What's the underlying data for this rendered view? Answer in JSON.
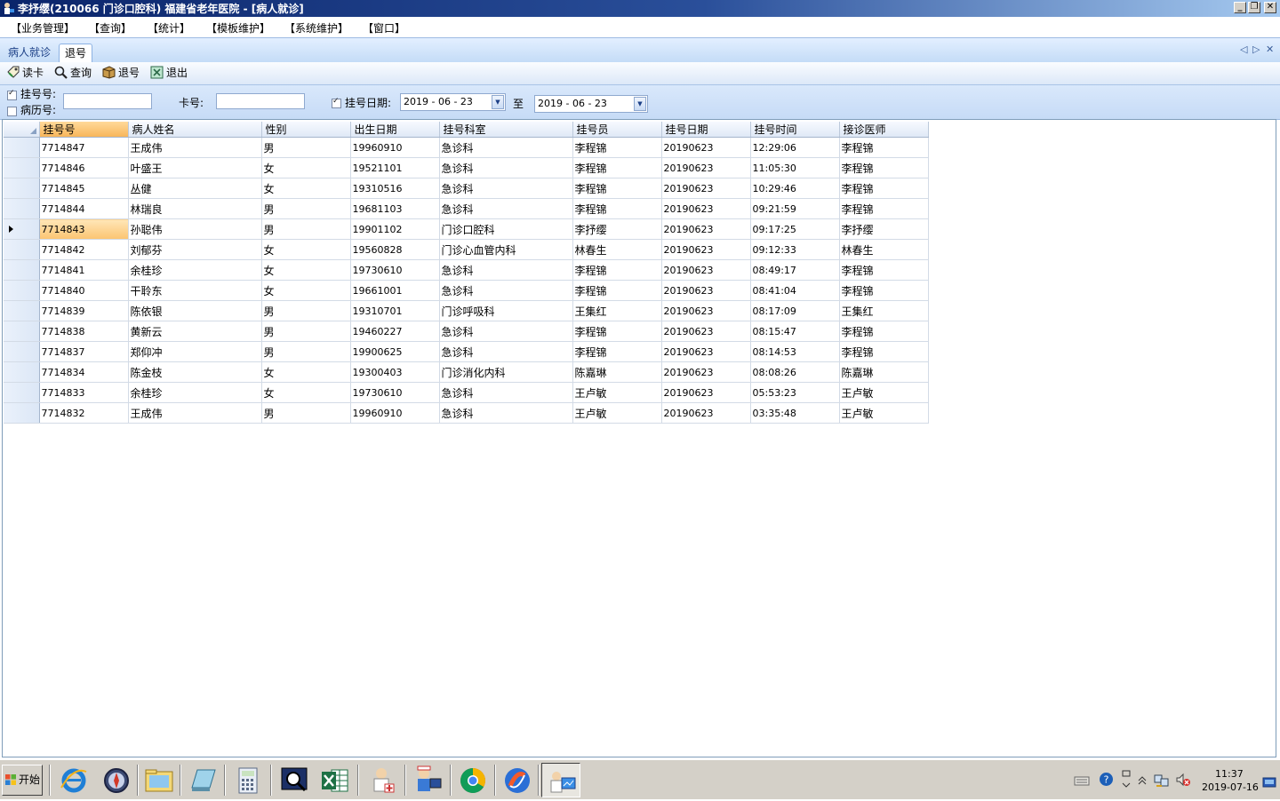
{
  "window": {
    "title": "李抒缨(210066 门诊口腔科) 福建省老年医院 - [病人就诊]",
    "controls": [
      "_",
      "❐",
      "✕"
    ]
  },
  "menu": [
    "【业务管理】",
    "【查询】",
    "【统计】",
    "【模板维护】",
    "【系统维护】",
    "【窗口】"
  ],
  "tabs": [
    {
      "label": "病人就诊",
      "active": false
    },
    {
      "label": "退号",
      "active": true
    }
  ],
  "tab_nav": {
    "prev": "◁",
    "next": "▷",
    "close": "✕"
  },
  "toolbar": {
    "read_card": "读卡",
    "query": "查询",
    "cancel_reg": "退号",
    "exit": "退出"
  },
  "filter": {
    "reg_no_label": "挂号号:",
    "reg_no_checked": true,
    "record_no_label": "病历号:",
    "record_no_checked": false,
    "reg_no_value": "",
    "card_label": "卡号:",
    "card_value": "",
    "date_label": "挂号日期:",
    "date_checked": true,
    "date_from": "2019 - 06 - 23",
    "to_label": "至",
    "date_to": "2019 - 06 - 23"
  },
  "grid": {
    "columns": [
      "挂号号",
      "病人姓名",
      "性别",
      "出生日期",
      "挂号科室",
      "挂号员",
      "挂号日期",
      "挂号时间",
      "接诊医师"
    ],
    "sorted_column": 0,
    "current_row": 4,
    "rows": [
      [
        "7714847",
        "王成伟",
        "男",
        "19960910",
        "急诊科",
        "李程锦",
        "20190623",
        "12:29:06",
        "李程锦"
      ],
      [
        "7714846",
        "叶盛王",
        "女",
        "19521101",
        "急诊科",
        "李程锦",
        "20190623",
        "11:05:30",
        "李程锦"
      ],
      [
        "7714845",
        "丛健",
        "女",
        "19310516",
        "急诊科",
        "李程锦",
        "20190623",
        "10:29:46",
        "李程锦"
      ],
      [
        "7714844",
        "林瑞良",
        "男",
        "19681103",
        "急诊科",
        "李程锦",
        "20190623",
        "09:21:59",
        "李程锦"
      ],
      [
        "7714843",
        "孙聪伟",
        "男",
        "19901102",
        "门诊口腔科",
        "李抒缨",
        "20190623",
        "09:17:25",
        "李抒缨"
      ],
      [
        "7714842",
        "刘郁芬",
        "女",
        "19560828",
        "门诊心血管内科",
        "林春生",
        "20190623",
        "09:12:33",
        "林春生"
      ],
      [
        "7714841",
        "余桂珍",
        "女",
        "19730610",
        "急诊科",
        "李程锦",
        "20190623",
        "08:49:17",
        "李程锦"
      ],
      [
        "7714840",
        "干聆东",
        "女",
        "19661001",
        "急诊科",
        "李程锦",
        "20190623",
        "08:41:04",
        "李程锦"
      ],
      [
        "7714839",
        "陈依银",
        "男",
        "19310701",
        "门诊呼吸科",
        "王集红",
        "20190623",
        "08:17:09",
        "王集红"
      ],
      [
        "7714838",
        "黄新云",
        "男",
        "19460227",
        "急诊科",
        "李程锦",
        "20190623",
        "08:15:47",
        "李程锦"
      ],
      [
        "7714837",
        "郑仰冲",
        "男",
        "19900625",
        "急诊科",
        "李程锦",
        "20190623",
        "08:14:53",
        "李程锦"
      ],
      [
        "7714834",
        "陈金枝",
        "女",
        "19300403",
        "门诊消化内科",
        "陈嘉琳",
        "20190623",
        "08:08:26",
        "陈嘉琳"
      ],
      [
        "7714833",
        "余桂珍",
        "女",
        "19730610",
        "急诊科",
        "王卢敏",
        "20190623",
        "05:53:23",
        "王卢敏"
      ],
      [
        "7714832",
        "王成伟",
        "男",
        "19960910",
        "急诊科",
        "王卢敏",
        "20190623",
        "03:35:48",
        "王卢敏"
      ]
    ]
  },
  "taskbar": {
    "start": "开始",
    "apps": [
      "ie-icon",
      "compass-icon",
      "folder-icon",
      "notebook-icon",
      "calculator-icon",
      "sql-query-icon",
      "excel-icon",
      "doctor-icon",
      "nurse-computer-icon",
      "chrome-icon",
      "sogou-icon",
      "hospital-app-icon"
    ],
    "clock_time": "11:37",
    "clock_date": "2019-07-16"
  },
  "colors": {
    "title_bar": "#0a246a",
    "tab_bg": "#c4dcf7",
    "sorted_header": "#f8b65a",
    "current_row": "#fbc471"
  }
}
